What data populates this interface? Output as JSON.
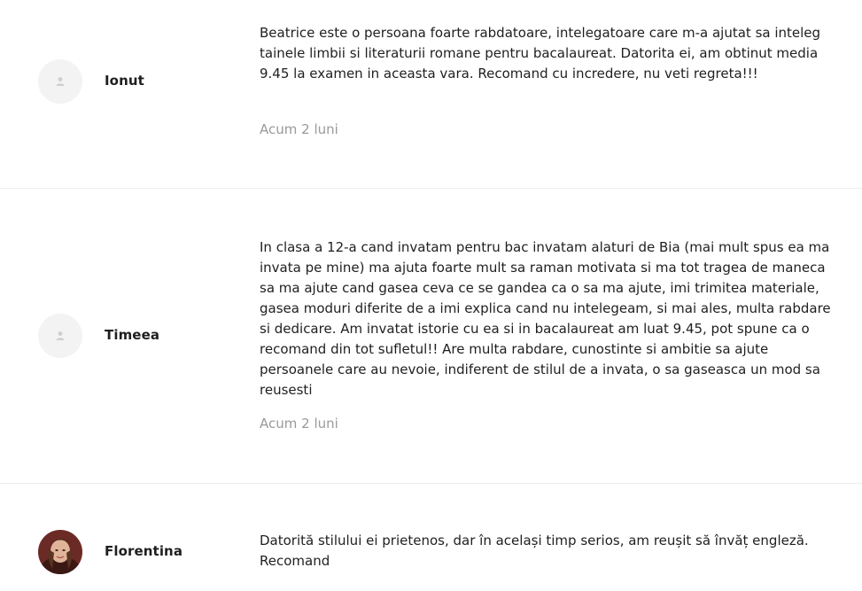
{
  "reviews": [
    {
      "author": "Ionut",
      "avatar": "default-user-icon",
      "text": "Beatrice este o persoana foarte rabdatoare, intelegatoare care m-a ajutat sa inteleg tainele limbii si literaturii romane pentru bacalaureat. Datorita ei, am obtinut media 9.45 la examen in aceasta vara. Recomand cu incredere, nu veti regreta!!!",
      "time": "Acum 2 luni"
    },
    {
      "author": "Timeea",
      "avatar": "default-user-icon",
      "text": "In clasa a 12-a cand invatam pentru bac invatam alaturi de Bia (mai mult spus ea ma invata pe mine) ma ajuta foarte mult sa raman motivata si ma tot tragea de maneca sa ma ajute cand gasea ceva ce se gandea ca o sa ma ajute, imi trimitea materiale, gasea moduri diferite de a imi explica cand nu intelegeam, si mai ales, multa rabdare si dedicare. Am invatat istorie cu ea si in bacalaureat am luat 9.45, pot spune ca o recomand din tot sufletul!! Are multa rabdare, cunostinte si ambitie sa ajute persoanele care au nevoie, indiferent de stilul de a invata, o sa gaseasca un mod sa reusesti",
      "time": "Acum 2 luni"
    },
    {
      "author": "Florentina",
      "avatar": "profile-photo",
      "text": "Datorită stilului ei prietenos, dar în același timp serios, am reușit să învăț engleză. Recomand"
    }
  ],
  "colors": {
    "text": "#1f1f1f",
    "muted": "#9a9a9a",
    "avatar_bg": "#f3f3f3",
    "divider": "#ececec"
  }
}
